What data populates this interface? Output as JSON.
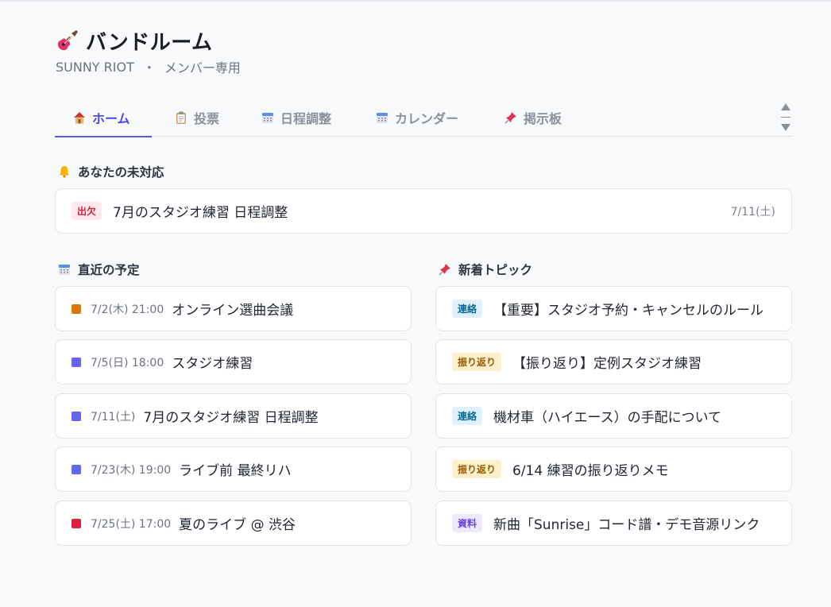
{
  "app": {
    "title": "バンドルーム",
    "band_name": "SUNNY RIOT",
    "separator": "・",
    "member_label": "メンバー専用"
  },
  "tabs": [
    {
      "label": "ホーム",
      "icon": "home-icon",
      "active": true
    },
    {
      "label": "投票",
      "icon": "clipboard-icon",
      "active": false
    },
    {
      "label": "日程調整",
      "icon": "calendar-icon",
      "active": false
    },
    {
      "label": "カレンダー",
      "icon": "calendar-icon",
      "active": false
    },
    {
      "label": "掲示板",
      "icon": "pushpin-icon",
      "active": false
    }
  ],
  "pending": {
    "title": "あなたの未対応",
    "items": [
      {
        "badge": "出欠",
        "text": "7月のスタジオ練習 日程調整",
        "date": "7/11(土)"
      }
    ]
  },
  "schedule": {
    "title": "直近の予定",
    "items": [
      {
        "time": "7/2(木) 21:00",
        "title": "オンライン選曲会議",
        "color": "#d97706"
      },
      {
        "time": "7/5(日) 18:00",
        "title": "スタジオ練習",
        "color": "#6366f1"
      },
      {
        "time": "7/11(土)",
        "title": "7月のスタジオ練習 日程調整",
        "color": "#6366f1"
      },
      {
        "time": "7/23(木) 19:00",
        "title": "ライブ前 最終リハ",
        "color": "#6366f1"
      },
      {
        "time": "7/25(土) 17:00",
        "title": "夏のライブ @ 渋谷",
        "color": "#e11d48"
      }
    ]
  },
  "topics": {
    "title": "新着トピック",
    "items": [
      {
        "badge": "連絡",
        "badge_style": "blue",
        "title": "【重要】スタジオ予約・キャンセルのルール"
      },
      {
        "badge": "振り返り",
        "badge_style": "yellow",
        "title": "【振り返り】定例スタジオ練習"
      },
      {
        "badge": "連絡",
        "badge_style": "blue",
        "title": "機材車（ハイエース）の手配について"
      },
      {
        "badge": "振り返り",
        "badge_style": "yellow",
        "title": "6/14 練習の振り返りメモ"
      },
      {
        "badge": "資料",
        "badge_style": "purple",
        "title": "新曲「Sunrise」コード譜・デモ音源リンク"
      }
    ]
  },
  "colors": {
    "accent": "#4f46e5",
    "background": "#f8f9fb"
  }
}
